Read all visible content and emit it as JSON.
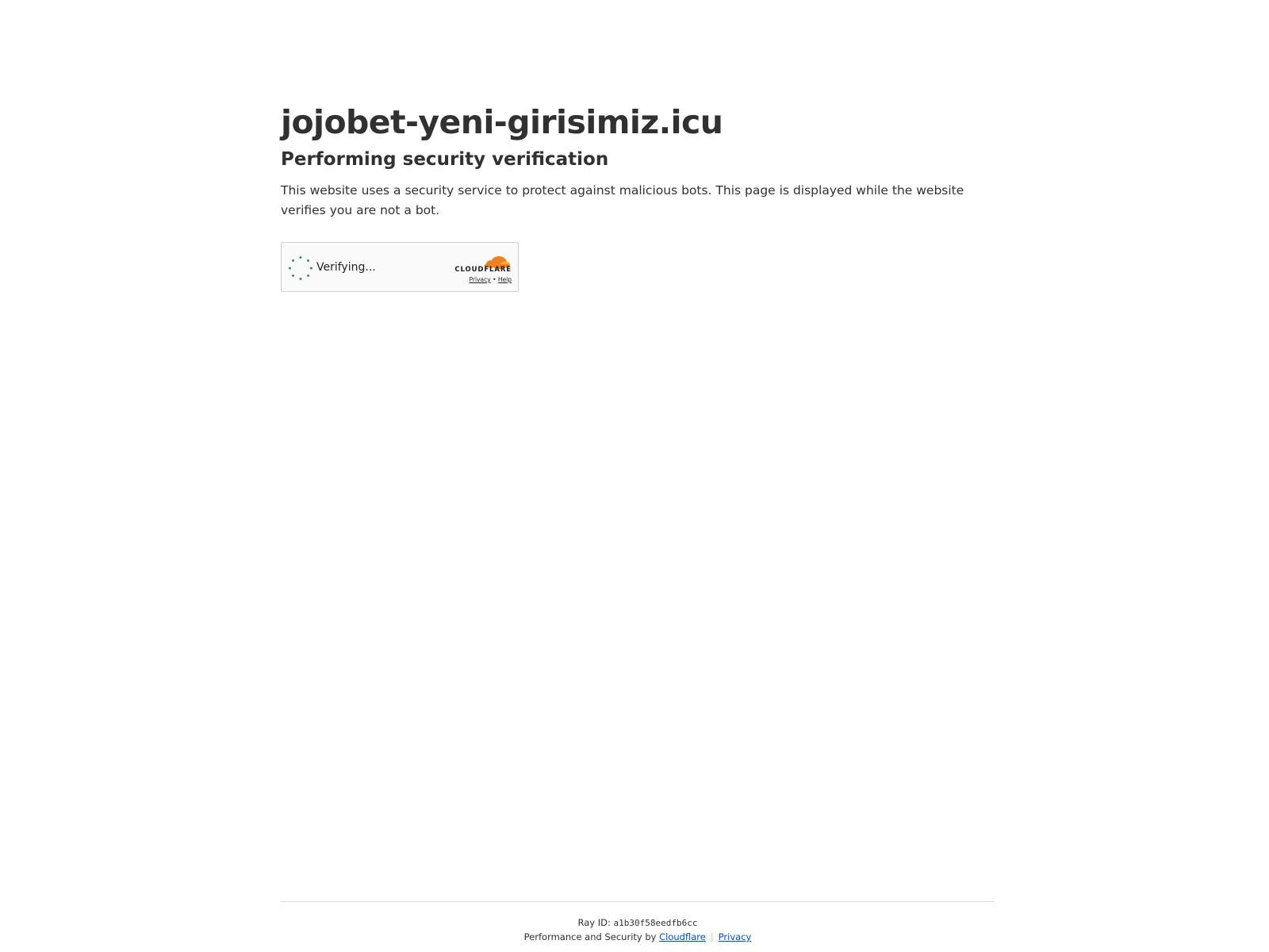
{
  "header": {
    "site_title": "jojobet-yeni-girisimiz.icu",
    "subtitle": "Performing security verification",
    "description": "This website uses a security service to protect against malicious bots. This page is displayed while the website verifies you are not a bot."
  },
  "widget": {
    "status_text": "Verifying...",
    "brand_name": "CLOUDFLARE",
    "privacy_link": "Privacy",
    "link_separator": "•",
    "help_link": "Help",
    "spinner_color": "#1e7f58",
    "logo_color_primary": "#f38020",
    "logo_color_secondary": "#faae40",
    "icons": [
      "spinner-icon",
      "cloudflare-logo-icon"
    ]
  },
  "footer": {
    "ray_label": "Ray ID:",
    "ray_id": "a1b30f58eedfb6cc",
    "performance_text": "Performance and Security by",
    "cloudflare_link": "Cloudflare",
    "separator": "|",
    "privacy_link": "Privacy",
    "link_color": "#0051c3"
  }
}
